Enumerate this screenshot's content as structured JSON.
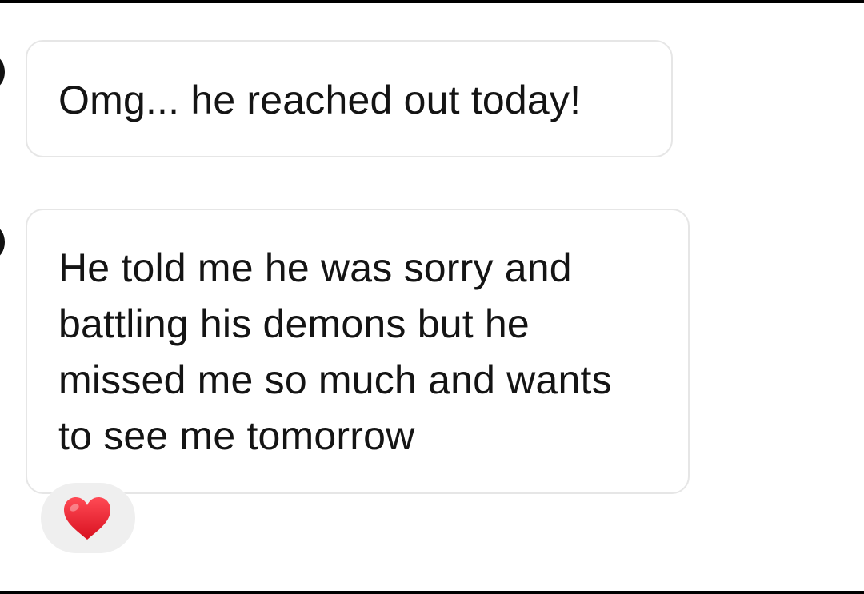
{
  "conversation": {
    "messages": [
      {
        "text": "Omg... he reached out today!"
      },
      {
        "text": "He told me he was sorry and battling his demons but he missed me so much and wants to see me tomorrow"
      }
    ],
    "reaction": {
      "icon": "heart-icon",
      "color": "#e8202f"
    }
  }
}
